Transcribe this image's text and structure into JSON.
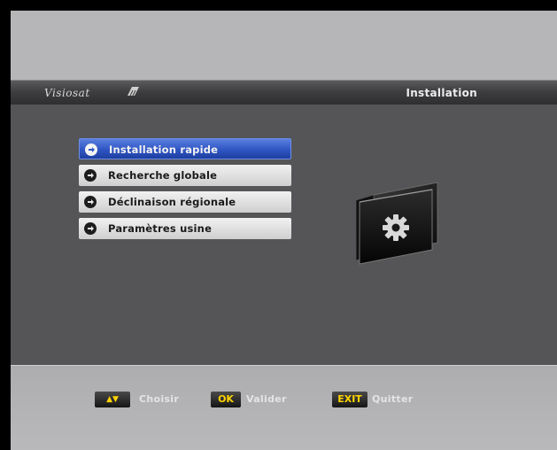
{
  "header": {
    "brand": "Visiosat",
    "title": "Installation"
  },
  "menu": {
    "items": [
      {
        "label": "Installation rapide",
        "selected": true
      },
      {
        "label": "Recherche globale",
        "selected": false
      },
      {
        "label": "Déclinaison régionale",
        "selected": false
      },
      {
        "label": "Paramètres usine",
        "selected": false
      }
    ]
  },
  "icon": {
    "name": "gear-folder-icon"
  },
  "footer": {
    "hints": [
      {
        "key": "▲▼",
        "action": "Choisir"
      },
      {
        "key": "OK",
        "action": "Valider"
      },
      {
        "key": "EXIT",
        "action": "Quitter"
      }
    ]
  },
  "colors": {
    "selected": "#2f55c4",
    "key_text": "#ffd400",
    "content_bg": "#555557",
    "header_bg": "#3e3e41"
  }
}
